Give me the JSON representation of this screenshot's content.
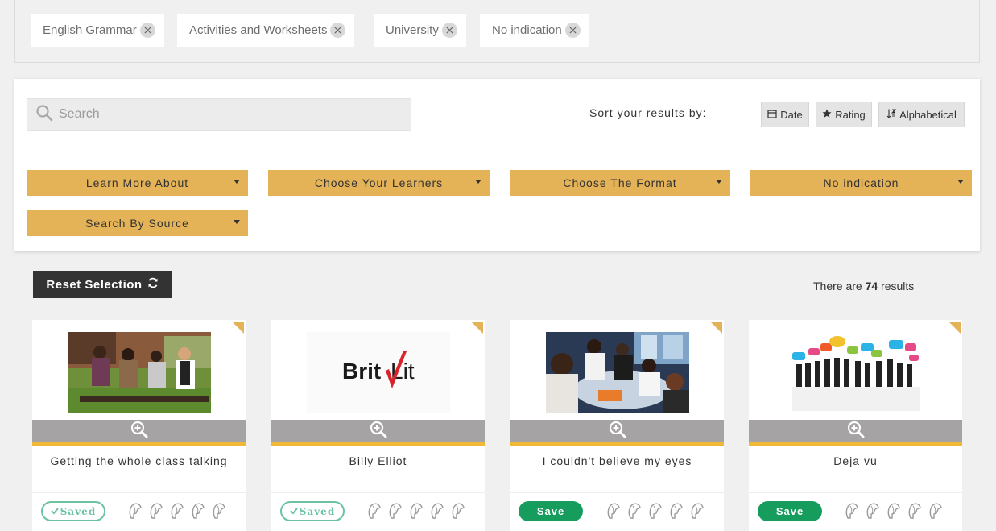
{
  "filters": {
    "chips": [
      {
        "label": "English Grammar"
      },
      {
        "label": "Activities and Worksheets"
      },
      {
        "label": "University"
      },
      {
        "label": "No indication"
      }
    ]
  },
  "search": {
    "placeholder": "Search",
    "value": ""
  },
  "sort": {
    "label": "Sort your results by:",
    "options": [
      {
        "label": "Date",
        "icon": "calendar-icon"
      },
      {
        "label": "Rating",
        "icon": "star-icon"
      },
      {
        "label": "Alphabetical",
        "icon": "sort-alpha-icon"
      }
    ]
  },
  "dropdowns": [
    {
      "label": "Learn More About"
    },
    {
      "label": "Choose Your Learners"
    },
    {
      "label": "Choose The Format"
    },
    {
      "label": "No indication"
    },
    {
      "label": "Search By Source"
    }
  ],
  "results": {
    "reset_label": "Reset Selection",
    "count_prefix": "There are ",
    "count": "74",
    "count_suffix": " results"
  },
  "cards": [
    {
      "title": "Getting the whole class talking",
      "button": "Saved",
      "saved": true,
      "image": "students-outdoors-photo"
    },
    {
      "title": "Billy Elliot",
      "button": "Saved",
      "saved": true,
      "image": "britlit-logo",
      "logo_text_a": "Brit",
      "logo_text_b": "Lit"
    },
    {
      "title": "I couldn't believe my eyes",
      "button": "Save",
      "saved": false,
      "image": "students-table-photo"
    },
    {
      "title": "Deja vu",
      "button": "Save",
      "saved": false,
      "image": "people-speech-bubbles-image"
    }
  ],
  "colors": {
    "accent": "#e4b257",
    "zoom_bar": "#a5a3a3",
    "save_green": "#169d5e",
    "saved_green": "#6cc3a1",
    "dark_button": "#333333"
  }
}
